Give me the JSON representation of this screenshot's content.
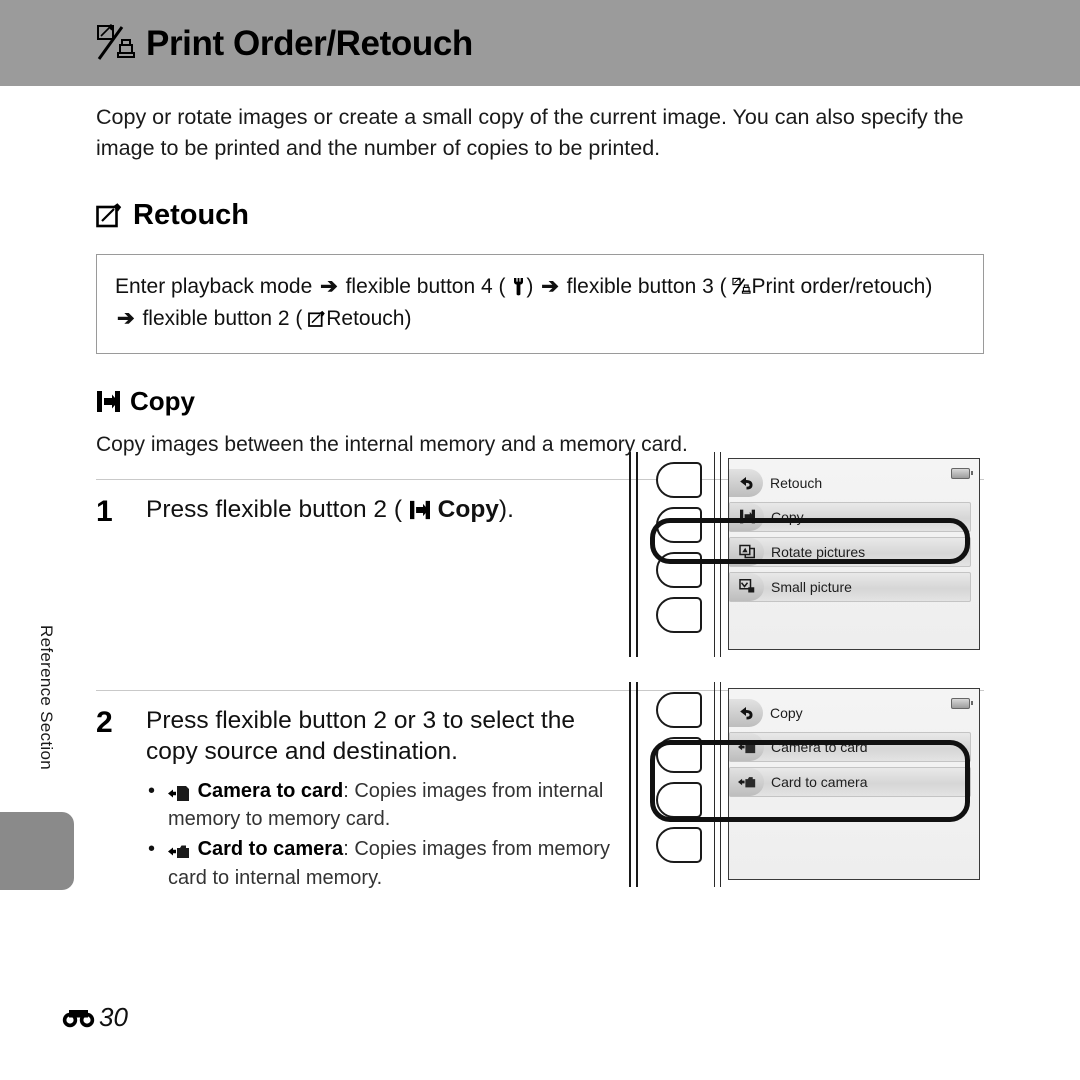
{
  "header": {
    "title": "Print Order/Retouch",
    "icon": "print-order-retouch-icon"
  },
  "side": {
    "label": "Reference Section"
  },
  "intro": "Copy or rotate images or create a small copy of the current image. You can also specify the image to be printed and the number of copies to be printed.",
  "retouch_section": {
    "heading": "Retouch",
    "icon": "retouch-pen-icon",
    "path_line_1_a": "Enter playback mode",
    "path_line_1_b": "flexible button 4 (",
    "path_line_1_c": ")",
    "path_line_1_d": "flexible button 3 (",
    "path_line_1_e": "Print order/retouch)",
    "path_line_2_a": "flexible button 2 (",
    "path_line_2_b": "Retouch)",
    "arrow": "➔"
  },
  "copy_section": {
    "heading": "Copy",
    "icon": "copy-icon",
    "description": "Copy images between the internal memory and a memory card."
  },
  "steps": [
    {
      "number": "1",
      "title_a": "Press flexible button 2 (",
      "title_b": "Copy",
      "title_c": ")."
    },
    {
      "number": "2",
      "title": "Press flexible button 2 or 3 to select the copy source and destination.",
      "bullets": [
        {
          "icon": "camera-to-card-icon",
          "term": "Camera to card",
          "sep": ": ",
          "desc": "Copies images from internal memory to memory card."
        },
        {
          "icon": "card-to-camera-icon",
          "term": "Card to camera",
          "sep": ": ",
          "desc": "Copies images from memory card to internal memory."
        }
      ]
    }
  ],
  "figure1": {
    "name": "retouch-menu-screen",
    "header_label": "Retouch",
    "header_icon": "back-arrow-icon",
    "battery": "battery-icon",
    "rows": [
      {
        "label": "Copy",
        "icon": "copy-icon",
        "highlighted": "true"
      },
      {
        "label": "Rotate pictures",
        "icon": "rotate-pictures-icon",
        "highlighted": "false"
      },
      {
        "label": "Small picture",
        "icon": "small-picture-icon",
        "highlighted": "false"
      }
    ],
    "buttons": [
      "flexible-button-1",
      "flexible-button-2",
      "flexible-button-3",
      "flexible-button-4"
    ]
  },
  "figure2": {
    "name": "copy-menu-screen",
    "header_label": "Copy",
    "header_icon": "back-arrow-icon",
    "battery": "battery-icon",
    "rows": [
      {
        "label": "Camera to card",
        "icon": "camera-to-card-icon",
        "highlighted": "true"
      },
      {
        "label": "Card to camera",
        "icon": "card-to-camera-icon",
        "highlighted": "true"
      }
    ],
    "buttons": [
      "flexible-button-1",
      "flexible-button-2",
      "flexible-button-3",
      "flexible-button-4"
    ]
  },
  "footer": {
    "marker": "reference-section-marker",
    "page": "30"
  },
  "colors": {
    "header_bar": "#9b9b9b",
    "side_tab": "#8a8a8a",
    "rule": "#c9c9c9",
    "text": "#1a1a1a"
  }
}
